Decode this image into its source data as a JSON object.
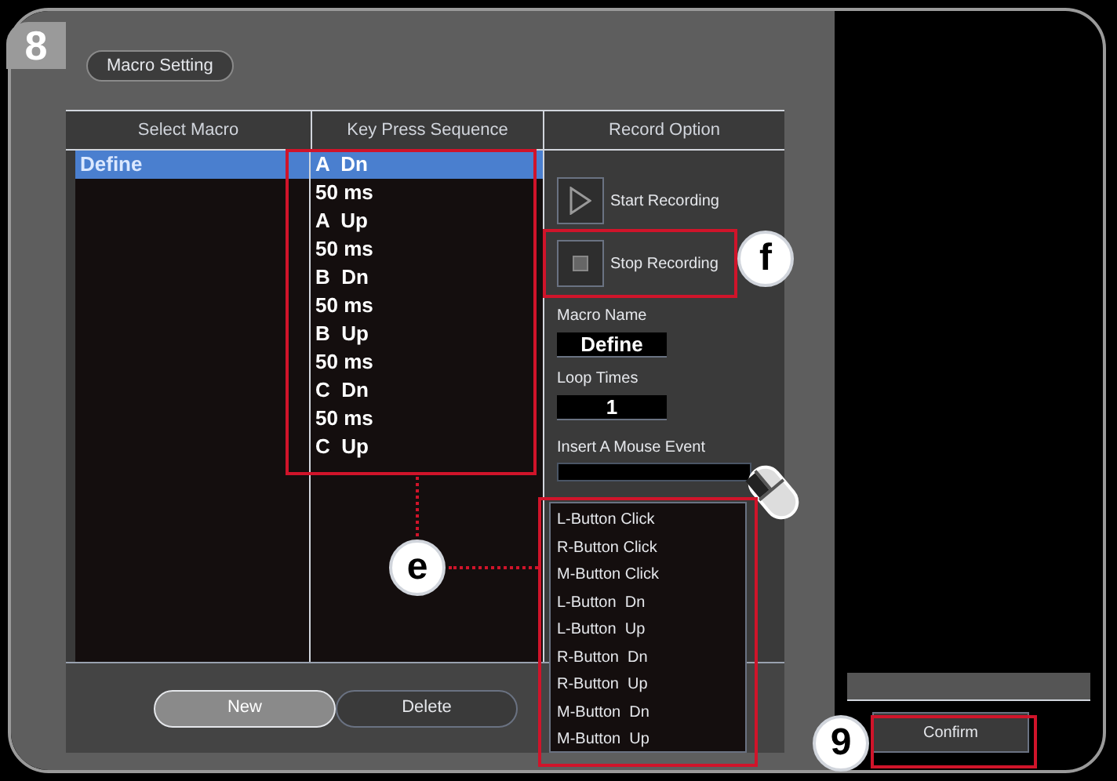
{
  "step_badge": "8",
  "panel_tab": "Macro Setting",
  "columns": [
    "Select Macro",
    "Key Press Sequence",
    "Record Option"
  ],
  "macros": [
    {
      "label": "Define",
      "selected": true
    }
  ],
  "sequence": [
    {
      "label": "A  Dn",
      "selected": true
    },
    {
      "label": "50 ms",
      "selected": false
    },
    {
      "label": "A  Up",
      "selected": false
    },
    {
      "label": "50 ms",
      "selected": false
    },
    {
      "label": "B  Dn",
      "selected": false
    },
    {
      "label": "50 ms",
      "selected": false
    },
    {
      "label": "B  Up",
      "selected": false
    },
    {
      "label": "50 ms",
      "selected": false
    },
    {
      "label": "C  Dn",
      "selected": false
    },
    {
      "label": "50 ms",
      "selected": false
    },
    {
      "label": "C  Up",
      "selected": false
    }
  ],
  "record_buttons": [
    {
      "kind": "start",
      "label": "Start Recording"
    },
    {
      "kind": "stop",
      "label": "Stop Recording"
    }
  ],
  "macro_name": {
    "label": "Macro Name",
    "value": "Define"
  },
  "loop_times": {
    "label": "Loop Times",
    "value": "1"
  },
  "mouse_event": {
    "label": "Insert A Mouse Event",
    "options": [
      "L-Button Click",
      "R-Button Click",
      "M-Button Click",
      "L-Button  Dn",
      "L-Button  Up",
      "R-Button  Dn",
      "R-Button  Up",
      "M-Button  Dn",
      "M-Button  Up"
    ]
  },
  "buttons": [
    {
      "label": "New",
      "selected": true
    },
    {
      "label": "Delete",
      "selected": false
    }
  ],
  "confirm": "Confirm",
  "callouts": [
    "e",
    "f",
    "9"
  ]
}
